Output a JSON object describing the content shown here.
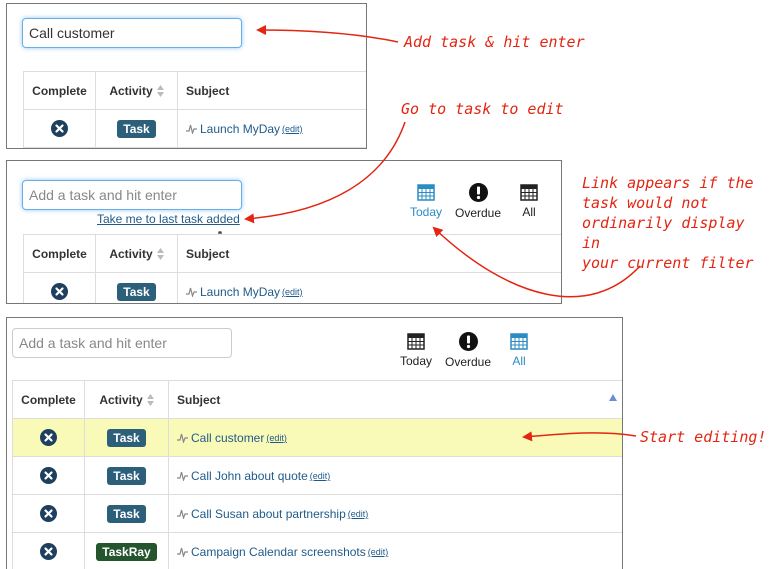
{
  "panel1": {
    "input_value": "Call customer",
    "headers": {
      "complete": "Complete",
      "activity": "Activity",
      "subject": "Subject"
    },
    "row": {
      "badge": "Task",
      "subject": "Launch MyDay",
      "edit": "(edit)"
    }
  },
  "panel2": {
    "input_placeholder": "Add a task and hit enter",
    "last_task_link": "Take me to last task added",
    "filters": {
      "today": "Today",
      "overdue": "Overdue",
      "all": "All"
    },
    "headers": {
      "complete": "Complete",
      "activity": "Activity",
      "subject": "Subject"
    },
    "row": {
      "badge": "Task",
      "subject": "Launch MyDay",
      "edit": "(edit)"
    }
  },
  "panel3": {
    "input_placeholder": "Add a task and hit enter",
    "filters": {
      "today": "Today",
      "overdue": "Overdue",
      "all": "All"
    },
    "headers": {
      "complete": "Complete",
      "activity": "Activity",
      "subject": "Subject"
    },
    "rows": [
      {
        "badge": "Task",
        "subject": "Call customer",
        "edit": "(edit)"
      },
      {
        "badge": "Task",
        "subject": "Call John about quote",
        "edit": "(edit)"
      },
      {
        "badge": "Task",
        "subject": "Call Susan about partnership",
        "edit": "(edit)"
      },
      {
        "badge": "TaskRay",
        "subject": "Campaign Calendar screenshots",
        "edit": "(edit)"
      }
    ]
  },
  "annotations": {
    "add_task": "Add task & hit enter",
    "go_to_task": "Go to task to edit",
    "link_appears": [
      "Link appears if the",
      "task would not",
      "ordinarily display in",
      "your current filter"
    ],
    "start_editing": "Start editing!"
  },
  "colors": {
    "annotation": "#e32512",
    "active_filter": "#2b8cc4",
    "highlight_row": "#fafab8",
    "task_badge": "#2c5f7a",
    "taskray_badge": "#24552c"
  }
}
